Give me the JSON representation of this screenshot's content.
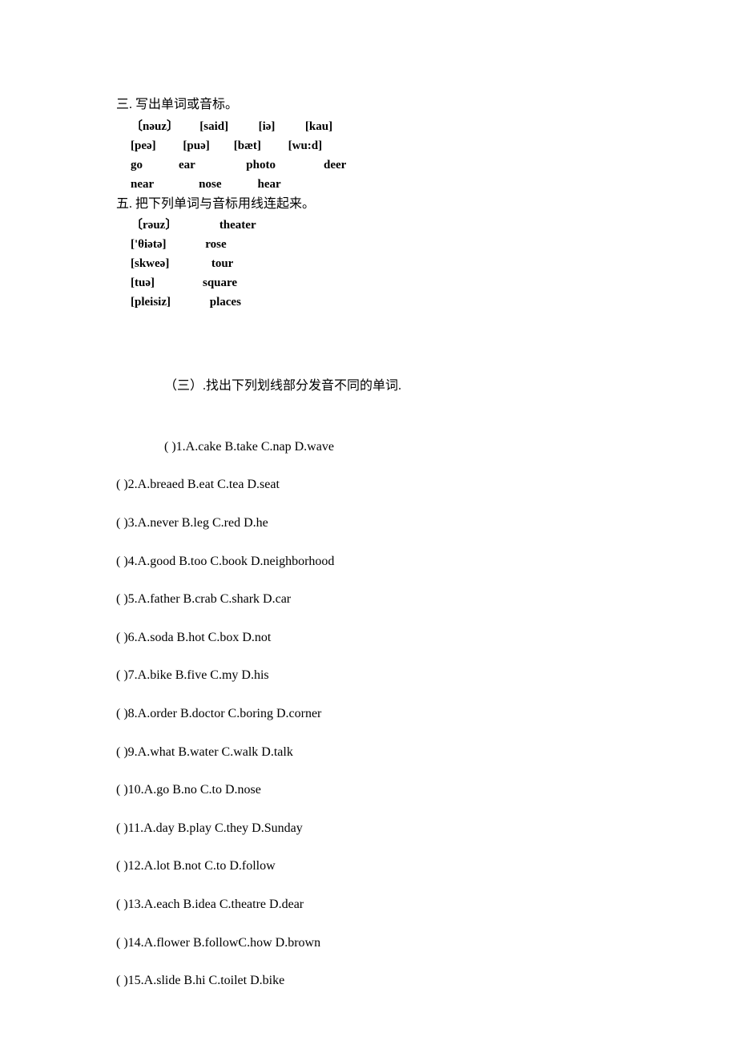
{
  "section3": {
    "title": "三. 写出单词或音标。",
    "row1": "〔nəuz〕       [said]          [iə]          [kau]",
    "row2": "[peə]         [puə]        [bæt]         [wu:d]",
    "row3": "go            ear                 photo                deer",
    "row4": "near               nose            hear"
  },
  "section5": {
    "title": "五. 把下列单词与音标用线连起来。",
    "row1": "〔rəuz〕              theater",
    "row2": "['θiətə]             rose",
    "row3": "[skweə]              tour",
    "row4": "[tuə]                square",
    "row5": "[pleisiz]             places"
  },
  "section_sub3": {
    "title": "（三）.找出下列划线部分发音不同的单词.",
    "questions": [
      "(   )1.A.cake  B.take  C.nap  D.wave",
      "(   )2.A.breaed  B.eat  C.tea  D.seat",
      "(   )3.A.never  B.leg  C.red  D.he",
      "(   )4.A.good  B.too C.book  D.neighborhood",
      "(   )5.A.father  B.crab  C.shark  D.car",
      "(   )6.A.soda  B.hot  C.box  D.not",
      "(   )7.A.bike  B.five  C.my  D.his",
      "(   )8.A.order  B.doctor  C.boring  D.corner",
      "(   )9.A.what  B.water  C.walk  D.talk",
      "(   )10.A.go  B.no  C.to  D.nose",
      "(   )11.A.day  B.play  C.they  D.Sunday",
      "(   )12.A.lot  B.not  C.to  D.follow",
      "(   )13.A.each  B.idea   C.theatre  D.dear",
      "(   )14.A.flower  B.followC.how    D.brown",
      "(   )15.A.slide  B.hi  C.toilet  D.bike"
    ]
  }
}
